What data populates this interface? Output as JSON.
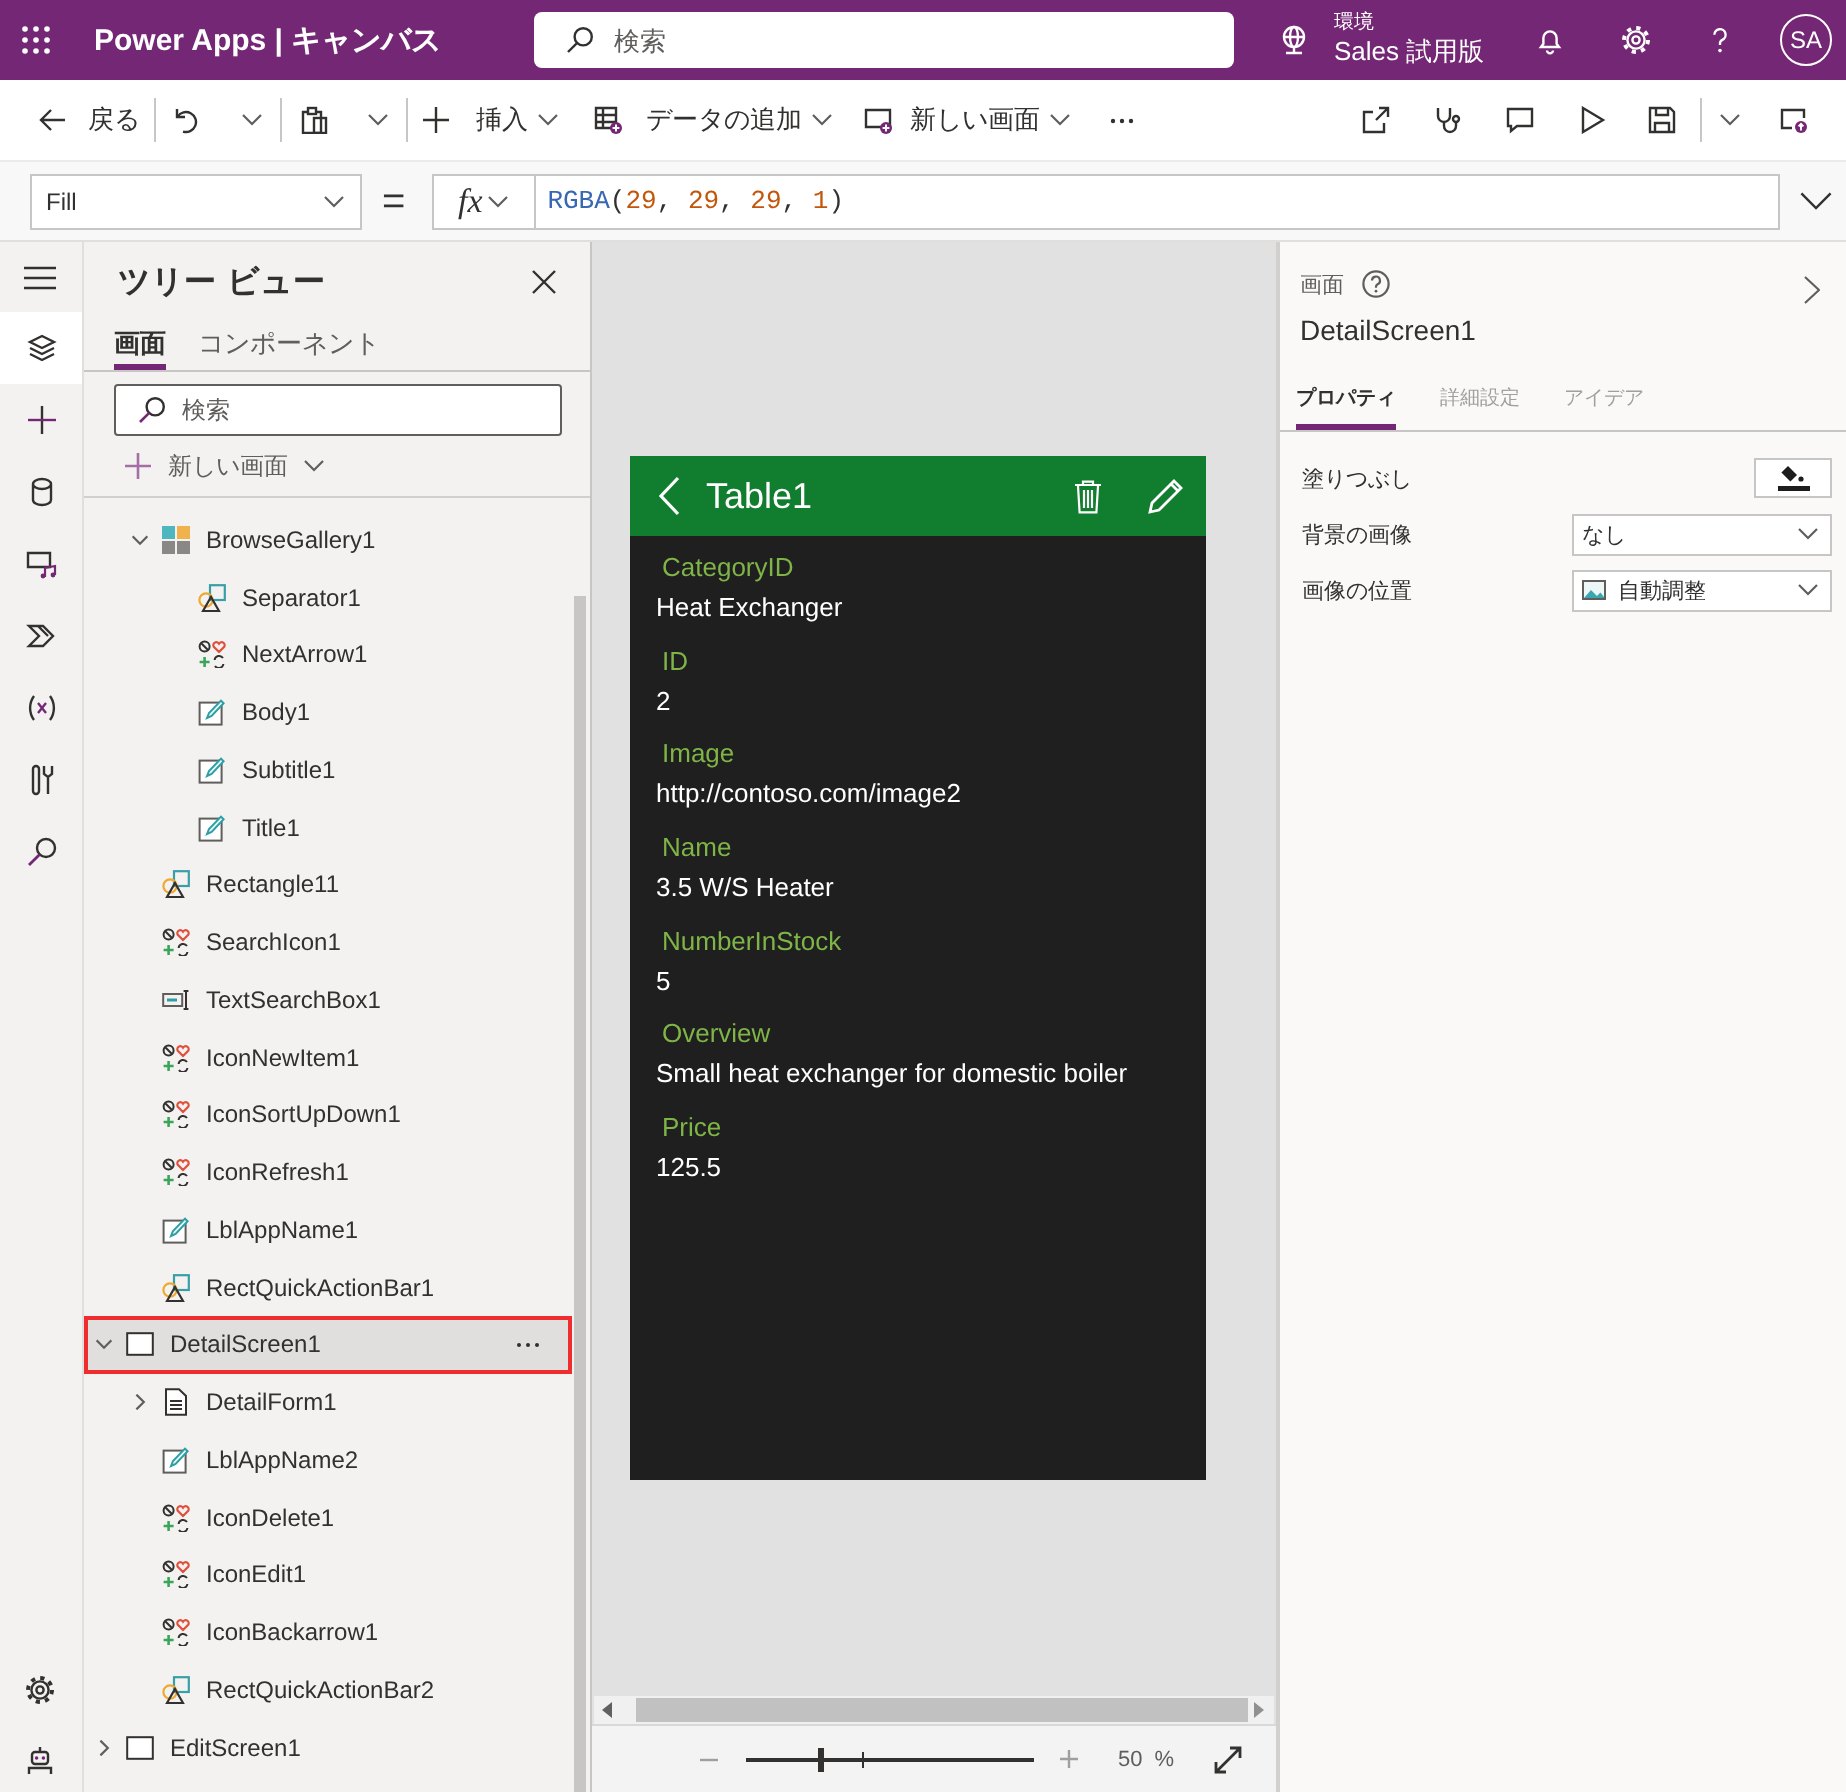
{
  "app_bar": {
    "title": "Power Apps | キャンバス",
    "search": {
      "placeholder": "検索"
    },
    "environment": {
      "label": "環境",
      "name": "Sales 試用版"
    },
    "avatar": "SA"
  },
  "command_bar": {
    "back": "戻る",
    "insert": "挿入",
    "add_data": "データの追加",
    "new_screen": "新しい画面"
  },
  "formula_bar": {
    "property": "Fill",
    "equals": "=",
    "fx": "fx",
    "formula": [
      {
        "kind": "function",
        "text": "RGBA"
      },
      {
        "kind": "punctuation",
        "text": "("
      },
      {
        "kind": "number",
        "text": "29"
      },
      {
        "kind": "punctuation",
        "text": ", "
      },
      {
        "kind": "number",
        "text": "29"
      },
      {
        "kind": "punctuation",
        "text": ", "
      },
      {
        "kind": "number",
        "text": "29"
      },
      {
        "kind": "punctuation",
        "text": ", "
      },
      {
        "kind": "number",
        "text": "1"
      },
      {
        "kind": "punctuation",
        "text": ")"
      }
    ]
  },
  "left_rail": {
    "tools": [
      {
        "kind": "tree_view",
        "selected": true
      },
      {
        "kind": "insert",
        "selected": false
      },
      {
        "kind": "data",
        "selected": false
      },
      {
        "kind": "media",
        "selected": false
      },
      {
        "kind": "automate",
        "selected": false
      },
      {
        "kind": "variables",
        "selected": false
      },
      {
        "kind": "tools",
        "selected": false
      },
      {
        "kind": "search",
        "selected": false
      }
    ]
  },
  "tree_panel": {
    "title": "ツリー ビュー",
    "tabs": [
      {
        "label": "画面",
        "selected": true
      },
      {
        "label": "コンポーネント",
        "selected": false
      }
    ],
    "search": {
      "placeholder": "検索"
    },
    "new_screen": "新しい画面",
    "tree": {
      "continued_items": [
        {
          "label": "BrowseGallery1",
          "kind": "gallery",
          "expanded": true,
          "selected": false,
          "children": [
            {
              "label": "Separator1",
              "kind": "shape",
              "selected": false
            },
            {
              "label": "NextArrow1",
              "kind": "icon",
              "selected": false
            },
            {
              "label": "Body1",
              "kind": "label",
              "selected": false
            },
            {
              "label": "Subtitle1",
              "kind": "label",
              "selected": false
            },
            {
              "label": "Title1",
              "kind": "label",
              "selected": false
            }
          ]
        },
        {
          "label": "Rectangle11",
          "kind": "shape",
          "selected": false
        },
        {
          "label": "SearchIcon1",
          "kind": "icon",
          "selected": false
        },
        {
          "label": "TextSearchBox1",
          "kind": "text_input",
          "selected": false
        },
        {
          "label": "IconNewItem1",
          "kind": "icon",
          "selected": false
        },
        {
          "label": "IconSortUpDown1",
          "kind": "icon",
          "selected": false
        },
        {
          "label": "IconRefresh1",
          "kind": "icon",
          "selected": false
        },
        {
          "label": "LblAppName1",
          "kind": "label",
          "selected": false
        },
        {
          "label": "RectQuickActionBar1",
          "kind": "shape",
          "selected": false
        }
      ],
      "screens": [
        {
          "label": "DetailScreen1",
          "kind": "screen",
          "expanded": true,
          "selected": true,
          "children": [
            {
              "label": "DetailForm1",
              "kind": "form",
              "expanded": false,
              "selected": false
            },
            {
              "label": "LblAppName2",
              "kind": "label",
              "selected": false
            },
            {
              "label": "IconDelete1",
              "kind": "icon",
              "selected": false
            },
            {
              "label": "IconEdit1",
              "kind": "icon",
              "selected": false
            },
            {
              "label": "IconBackarrow1",
              "kind": "icon",
              "selected": false
            },
            {
              "label": "RectQuickActionBar2",
              "kind": "shape",
              "selected": false
            }
          ]
        },
        {
          "label": "EditScreen1",
          "kind": "screen",
          "expanded": false,
          "selected": false
        }
      ]
    }
  },
  "canvas": {
    "screen": {
      "title": "Table1",
      "fields": [
        {
          "label": "CategoryID",
          "value": "Heat Exchanger"
        },
        {
          "label": "ID",
          "value": "2"
        },
        {
          "label": "Image",
          "value": "http://contoso.com/image2"
        },
        {
          "label": "Name",
          "value": "3.5 W/S Heater"
        },
        {
          "label": "NumberInStock",
          "value": "5"
        },
        {
          "label": "Overview",
          "value": "Small heat exchanger for domestic boiler"
        },
        {
          "label": "Price",
          "value": "125.5"
        }
      ]
    },
    "zoom": {
      "level": 0.26,
      "value": "50",
      "unit": "%"
    }
  },
  "properties_panel": {
    "category": "画面",
    "name": "DetailScreen1",
    "tabs": [
      {
        "label": "プロパティ",
        "selected": true
      },
      {
        "label": "詳細設定",
        "selected": false
      },
      {
        "label": "アイデア",
        "selected": false
      }
    ],
    "rows": [
      {
        "kind": "color",
        "label": "塗りつぶし"
      },
      {
        "kind": "dropdown",
        "label": "背景の画像",
        "value": "なし"
      },
      {
        "kind": "image_dropdown",
        "label": "画像の位置",
        "value": "自動調整"
      }
    ]
  }
}
